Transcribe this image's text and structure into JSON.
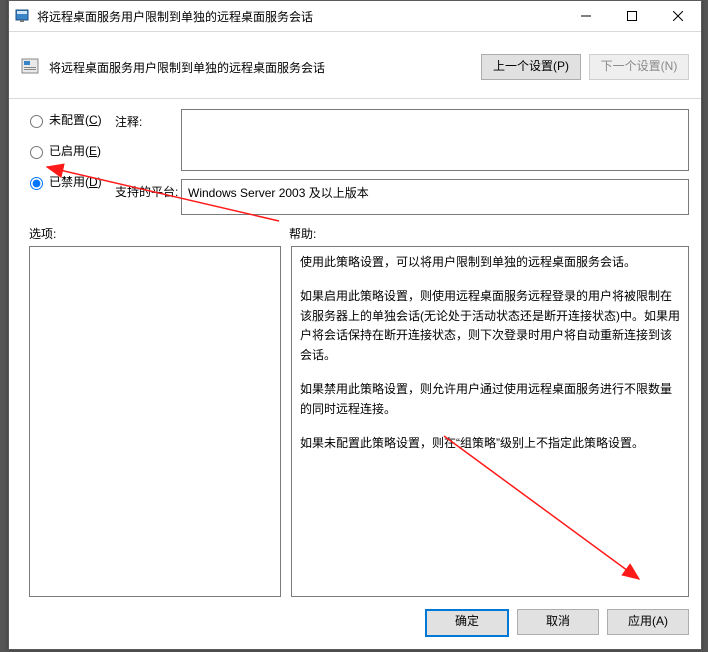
{
  "window": {
    "title": "将远程桌面服务用户限制到单独的远程桌面服务会话"
  },
  "header": {
    "title": "将远程桌面服务用户限制到单独的远程桌面服务会话",
    "prev_label": "上一个设置(P)",
    "next_label": "下一个设置(N)"
  },
  "radios": {
    "not_configured": "未配置(C)",
    "enabled": "已启用(E)",
    "disabled": "已禁用(D)",
    "selected": "disabled"
  },
  "labels": {
    "comment": "注释:",
    "platform": "支持的平台:",
    "options": "选项:",
    "help": "帮助:"
  },
  "platform_text": "Windows Server 2003 及以上版本",
  "help": {
    "p1": "使用此策略设置，可以将用户限制到单独的远程桌面服务会话。",
    "p2": "如果启用此策略设置，则使用远程桌面服务远程登录的用户将被限制在该服务器上的单独会话(无论处于活动状态还是断开连接状态)中。如果用户将会话保持在断开连接状态，则下次登录时用户将自动重新连接到该会话。",
    "p3": "如果禁用此策略设置，则允许用户通过使用远程桌面服务进行不限数量的同时远程连接。",
    "p4": "如果未配置此策略设置，则在“组策略”级别上不指定此策略设置。"
  },
  "footer": {
    "ok": "确定",
    "cancel": "取消",
    "apply": "应用(A)"
  }
}
